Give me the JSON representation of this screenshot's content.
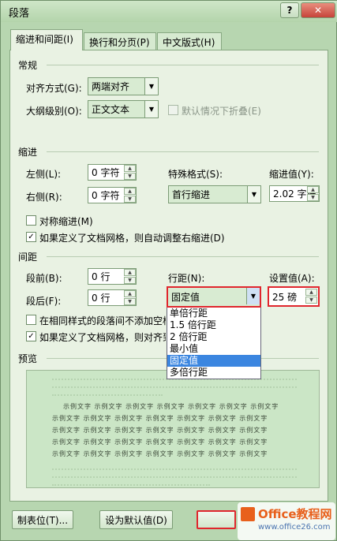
{
  "window": {
    "title": "段落"
  },
  "titlebar_buttons": {
    "help": "?",
    "close": "✕"
  },
  "tabs": [
    "缩进和间距(I)",
    "换行和分页(P)",
    "中文版式(H)"
  ],
  "general": {
    "heading": "常规",
    "alignment_label": "对齐方式(G):",
    "alignment_value": "两端对齐",
    "outline_label": "大纲级别(O):",
    "outline_value": "正文文本",
    "collapse_label": "默认情况下折叠(E)"
  },
  "indent": {
    "heading": "缩进",
    "left_label": "左侧(L):",
    "left_value": "0 字符",
    "right_label": "右侧(R):",
    "right_value": "0 字符",
    "special_label": "特殊格式(S):",
    "special_value": "首行缩进",
    "by_label": "缩进值(Y):",
    "by_value": "2.02 字符",
    "mirror_label": "对称缩进(M)",
    "auto_adjust_label": "如果定义了文档网格，则自动调整右缩进(D)"
  },
  "spacing": {
    "heading": "间距",
    "before_label": "段前(B):",
    "before_value": "0 行",
    "after_label": "段后(F):",
    "after_value": "0 行",
    "line_spacing_label": "行距(N):",
    "line_spacing_value": "固定值",
    "at_label": "设置值(A):",
    "at_value": "25 磅",
    "no_space_label": "在相同样式的段落间不添加空格",
    "snap_grid_label": "如果定义了文档网格，则对齐到网",
    "options": [
      "单倍行距",
      "1.5 倍行距",
      "2 倍行距",
      "最小值",
      "固定值",
      "多倍行距"
    ],
    "selected_option": "固定值"
  },
  "preview": {
    "heading": "预览",
    "sample_text": "示例文字 示例文字 示例文字 示例文字 示例文字 示例文字 示例文字"
  },
  "footer": {
    "tabs_button": "制表位(T)...",
    "default_button": "设为默认值(D)"
  },
  "watermark": {
    "brand": "Office教程网",
    "url": "www.office26.com"
  },
  "colors": {
    "dialog": "#b7d6b0",
    "panel": "#e9f2e3",
    "highlight": "#e0262d",
    "selection": "#3b86e0"
  }
}
